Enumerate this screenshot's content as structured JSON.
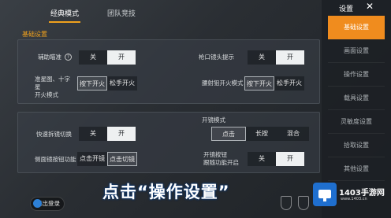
{
  "tabs": {
    "basic": "经典模式",
    "team": "团队竞技"
  },
  "section_label": "基础设置",
  "panel1": {
    "aim_assist": {
      "label": "辅助瞄准",
      "off": "关",
      "on": "开"
    },
    "hit_prompt": {
      "label": "枪口镜头提示",
      "off": "关",
      "on": "开"
    },
    "sight_fire": {
      "label": "准星图、十字星\n开火模式",
      "opt1": "按下开火",
      "opt2": "松手开火"
    },
    "scope_fire": {
      "label": "腰射狙开火模式",
      "opt1": "按下开火",
      "opt2": "松手开火"
    }
  },
  "panel2": {
    "quick_switch": {
      "label": "快速拆镜切换",
      "off": "关",
      "on": "开"
    },
    "fire_mode": {
      "label": "开镜模式",
      "opt1": "点击",
      "opt2": "长按",
      "opt3": "混合"
    },
    "side_switch": {
      "label": "侧面镜按钮功能",
      "opt1": "点击开镜",
      "opt2": "点击切镜"
    },
    "scope_follow": {
      "label": "开镜按钮\n跟随功能开启",
      "off": "关",
      "on": "开"
    }
  },
  "sidebar": {
    "title": "设置",
    "items": [
      "基础设置",
      "画面设置",
      "操作设置",
      "载具设置",
      "灵敏度设置",
      "拾取设置",
      "其他设置"
    ]
  },
  "logout": "退出登录",
  "caption": "点击“操作设置”",
  "watermark": {
    "title": "1403手游网",
    "sub": "www.1403.cn"
  }
}
